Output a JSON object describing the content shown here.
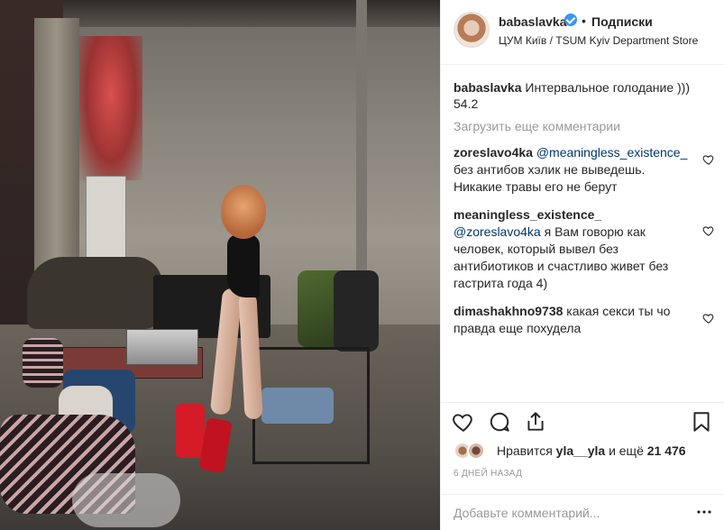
{
  "header": {
    "username": "babaslavka",
    "dot": "•",
    "follow_label": "Подписки",
    "location": "ЦУМ Київ / TSUM Kyiv Department Store"
  },
  "caption": {
    "username": "babaslavka",
    "text": "Интервальное голодание ))) 54.2"
  },
  "load_more_label": "Загрузить еще комментарии",
  "comments": [
    {
      "username": "zoreslavo4ka",
      "mention": "@meaningless_existence_",
      "text": "без антибов хэлик не выведешь. Никакие травы его не берут"
    },
    {
      "username": "meaningless_existence_",
      "mention": "@zoreslavo4ka",
      "text": "я Вам говорю как человек, который вывел без антибиотиков и счастливо живет без гастрита года 4)"
    },
    {
      "username": "dimashakhno9738",
      "mention": "",
      "text": "какая секси ты чо правда еще похудела"
    }
  ],
  "likes": {
    "prefix": "Нравится",
    "user": "yla__yla",
    "middle": "и ещё",
    "count": "21 476"
  },
  "time_label": "6 ДНЕЙ НАЗАД",
  "add_comment": {
    "placeholder": "Добавьте комментарий..."
  },
  "colors": {
    "verified": "#3897f0",
    "mention": "#003569",
    "muted": "#999999"
  },
  "icons": [
    "heart-icon",
    "comment-icon",
    "share-icon",
    "bookmark-icon",
    "verified-icon",
    "more-dots-icon"
  ]
}
